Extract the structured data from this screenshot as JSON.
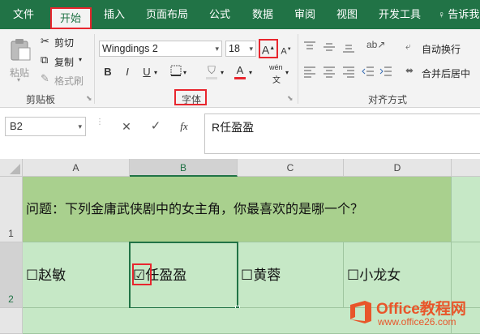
{
  "ribbon_tabs": [
    "文件",
    "开始",
    "插入",
    "页面布局",
    "公式",
    "数据",
    "审阅",
    "视图",
    "开发工具",
    "告诉我"
  ],
  "clipboard": {
    "paste": "粘贴",
    "cut": "剪切",
    "copy": "复制",
    "format_painter": "格式刷",
    "group_label": "剪贴板"
  },
  "font": {
    "name": "Wingdings 2",
    "size": "18",
    "increase_size": "A",
    "decrease_size": "A",
    "bold": "B",
    "italic": "I",
    "underline": "U",
    "font_color": "A",
    "phonetic": "wén",
    "group_label": "字体"
  },
  "alignment": {
    "wrap_text": "自动换行",
    "merge_center": "合并后居中",
    "group_label": "对齐方式"
  },
  "formula_bar": {
    "name_box": "B2",
    "cancel": "✕",
    "enter": "✓",
    "fx": "fx",
    "formula": "R任盈盈"
  },
  "sheet": {
    "columns": [
      "A",
      "B",
      "C",
      "D"
    ],
    "rows": [
      "1",
      "2"
    ],
    "row1_question": "问题：下列金庸武侠剧中的女主角，你最喜欢的是哪一个？",
    "options": [
      "☐赵敏",
      "☑任盈盈",
      "☐黄蓉",
      "☐小龙女"
    ]
  },
  "watermark": {
    "site": "Office教程网",
    "url": "www.office26.com"
  },
  "colors": {
    "accent": "#217346",
    "highlight_red": "#e8262e",
    "cell_green": "#a9d08e",
    "cell_light_green": "#c6e8c6"
  }
}
